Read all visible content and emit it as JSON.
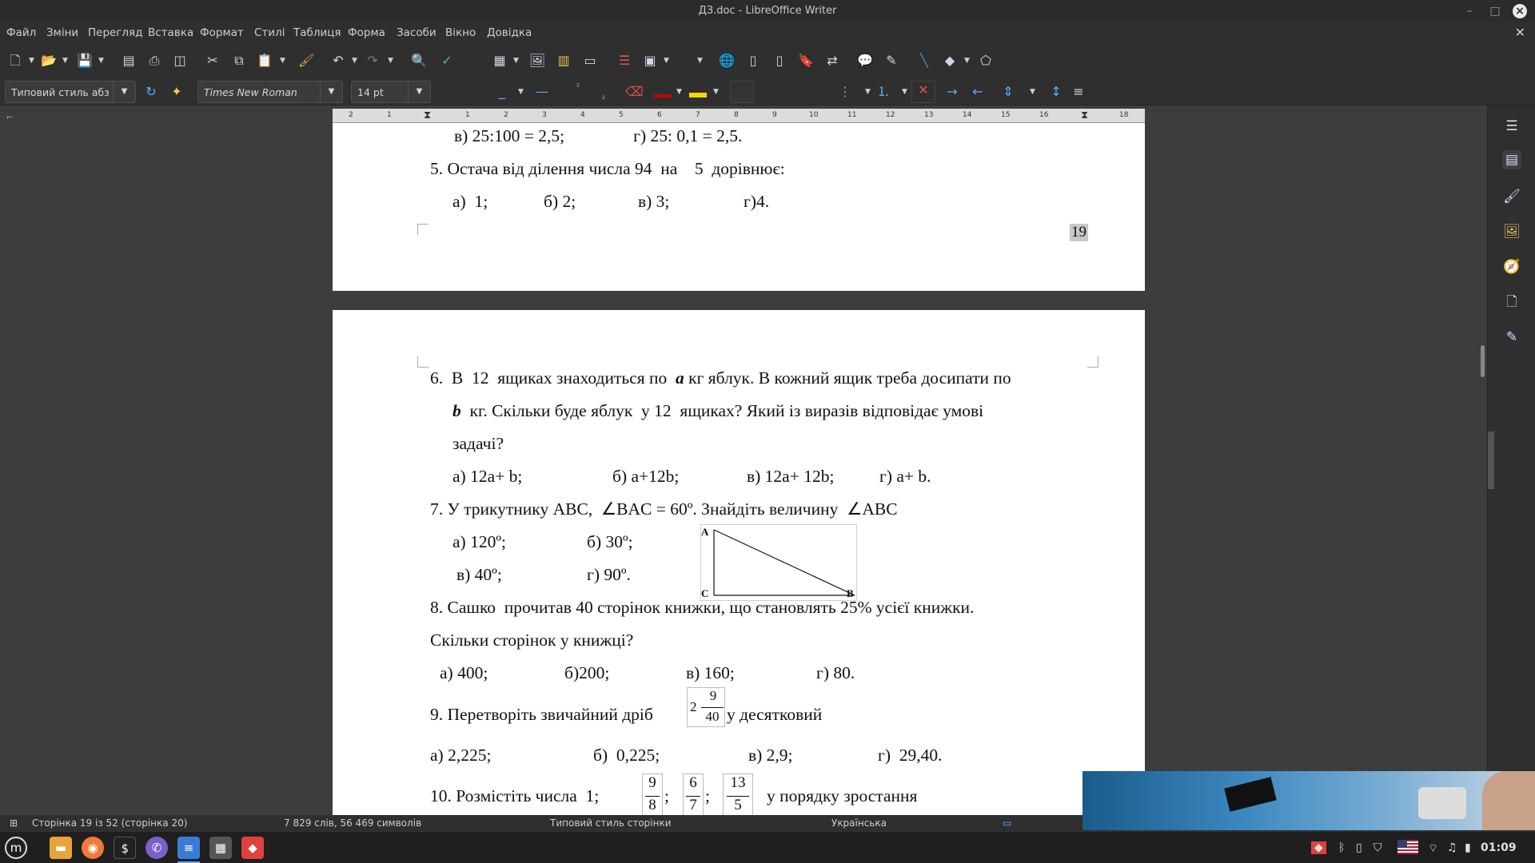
{
  "window": {
    "title": "ДЗ.doc - LibreOffice Writer"
  },
  "menu": [
    "Файл",
    "Зміни",
    "Перегляд",
    "Вставка",
    "Формат",
    "Стилі",
    "Таблиця",
    "Форма",
    "Засоби",
    "Вікно",
    "Довідка"
  ],
  "format_bar": {
    "paragraph_style": "Типовий стиль абзацу",
    "font_name": "Times New Roman",
    "font_size": "14 pt"
  },
  "ruler": [
    "2",
    "1",
    "1",
    "2",
    "3",
    "4",
    "5",
    "6",
    "7",
    "8",
    "9",
    "10",
    "11",
    "12",
    "13",
    "14",
    "15",
    "16",
    "18"
  ],
  "page1": {
    "line_v": "в) 25:100 = 2,5;                г) 25: 0,1 = 2,5.",
    "q5": "5. Остача від ділення числа 94  на    5  дорівнює:",
    "q5_a": "а)  1;",
    "q5_b": "б) 2;",
    "q5_c": "в) 3;",
    "q5_d": "г)4.",
    "page_number": "19"
  },
  "page2": {
    "q6_l1_pre": "6.  В  12  ящиках знаходиться по  ",
    "q6_a_var": "а",
    "q6_l1_post": " кг яблук. В кожний ящик треба досипати по",
    "q6_b_var": "b",
    "q6_l2": "  кг. Скільки буде яблук  у 12  ящиках? Який із виразів відповідає умові",
    "q6_l3": "задачі?",
    "q6_a": "а) 12a+ b;",
    "q6_b": "б) a+12b;",
    "q6_c": "в) 12a+ 12b;",
    "q6_d": "г) a+ b.",
    "q7": "7. У трикутнику АВС,  ∠BAC = 60º. Знайдіть величину  ∠АВС",
    "q7_a": "а) 120º;",
    "q7_b": "б) 30º;",
    "q7_c": "в) 40º;",
    "q7_d": "г) 90º.",
    "tri_A": "A",
    "tri_B": "B",
    "tri_C": "C",
    "q8_l1": "8. Сашко  прочитав 40 сторінок книжки, що становлять 25% усієї книжки.",
    "q8_l2": "Скільки сторінок у книжці?",
    "q8_a": "а) 400;",
    "q8_b": "б)200;",
    "q8_c": "в) 160;",
    "q8_d": "г) 80.",
    "q9_pre": "9. Перетворіть звичайний дріб",
    "q9_whole": "2",
    "q9_num": "9",
    "q9_den": "40",
    "q9_post": "у десятковий",
    "q9_a": "а) 2,225;",
    "q9_b": "б)  0,225;",
    "q9_c": "в) 2,9;",
    "q9_d": "г)  29,40.",
    "q10_pre": "10. Розмістіть числа  1;",
    "q10_f1_num": "9",
    "q10_f1_den": "8",
    "q10_f2_num": "6",
    "q10_f2_den": "7",
    "q10_f3_num": "13",
    "q10_f3_den": "5",
    "q10_sep": ";",
    "q10_post": "у порядку зростання"
  },
  "status": {
    "page": "Сторінка 19 із 52 (сторінка 20)",
    "words": "7 829 слів, 56 469 символів",
    "page_style": "Типовий стиль сторінки",
    "language": "Українська"
  },
  "taskbar": {
    "clock": "01:09"
  }
}
